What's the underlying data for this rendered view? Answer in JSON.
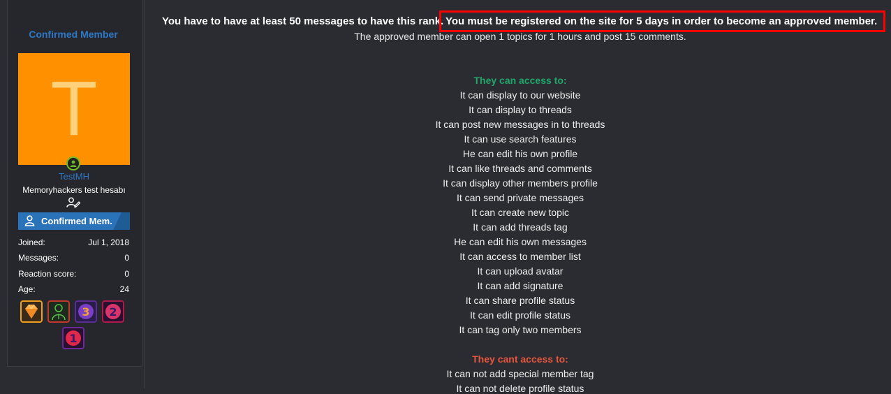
{
  "sidebar": {
    "rank_title": "Confirmed Member",
    "avatar_letter": "T",
    "username": "TestMH",
    "user_title": "Memoryhackers test hesabı",
    "banner_label": "Confirmed Mem.",
    "stats": [
      {
        "label": "Joined:",
        "value": "Jul 1, 2018"
      },
      {
        "label": "Messages:",
        "value": "0"
      },
      {
        "label": "Reaction score:",
        "value": "0"
      },
      {
        "label": "Age:",
        "value": "24"
      }
    ],
    "trophies": [
      "diamond-trophy-icon",
      "agent-trophy-icon",
      "number-3-trophy-icon",
      "number-2-trophy-icon",
      "number-1-trophy-icon"
    ],
    "colors": {
      "avatar_bg": "#ff9000",
      "accent_blue": "#2e78c7",
      "online_green": "#6dbb28"
    }
  },
  "main": {
    "rule_part1": "You have to have at least 50 messages to have this rank.",
    "rule_part2": "You must be registered on the site for 5 days in order to become an approved member.",
    "approved_line": "The approved member can open 1 topics for 1 hours and post 15 comments.",
    "access_heading": "They can access to:",
    "access_items": [
      "It can display to our website",
      "It can display to threads",
      "It can post new messages in to threads",
      "It can use search features",
      "He can edit his own profile",
      "It can like threads and comments",
      "It can display other members profile",
      "It can send private messages",
      "It can create new topic",
      "It can add threads tag",
      "He can edit his own messages",
      "It can access to member list",
      "It can upload avatar",
      "It can add signature",
      "It can share profile status",
      "It can edit profile status",
      "It can tag only two members"
    ],
    "cant_heading": "They cant access to:",
    "cant_items": [
      "It can not add special member tag",
      "It can not delete profile status"
    ],
    "colors": {
      "access_heading": "#21a66b",
      "cant_heading": "#e8553d",
      "highlight": "#ff0000"
    }
  }
}
